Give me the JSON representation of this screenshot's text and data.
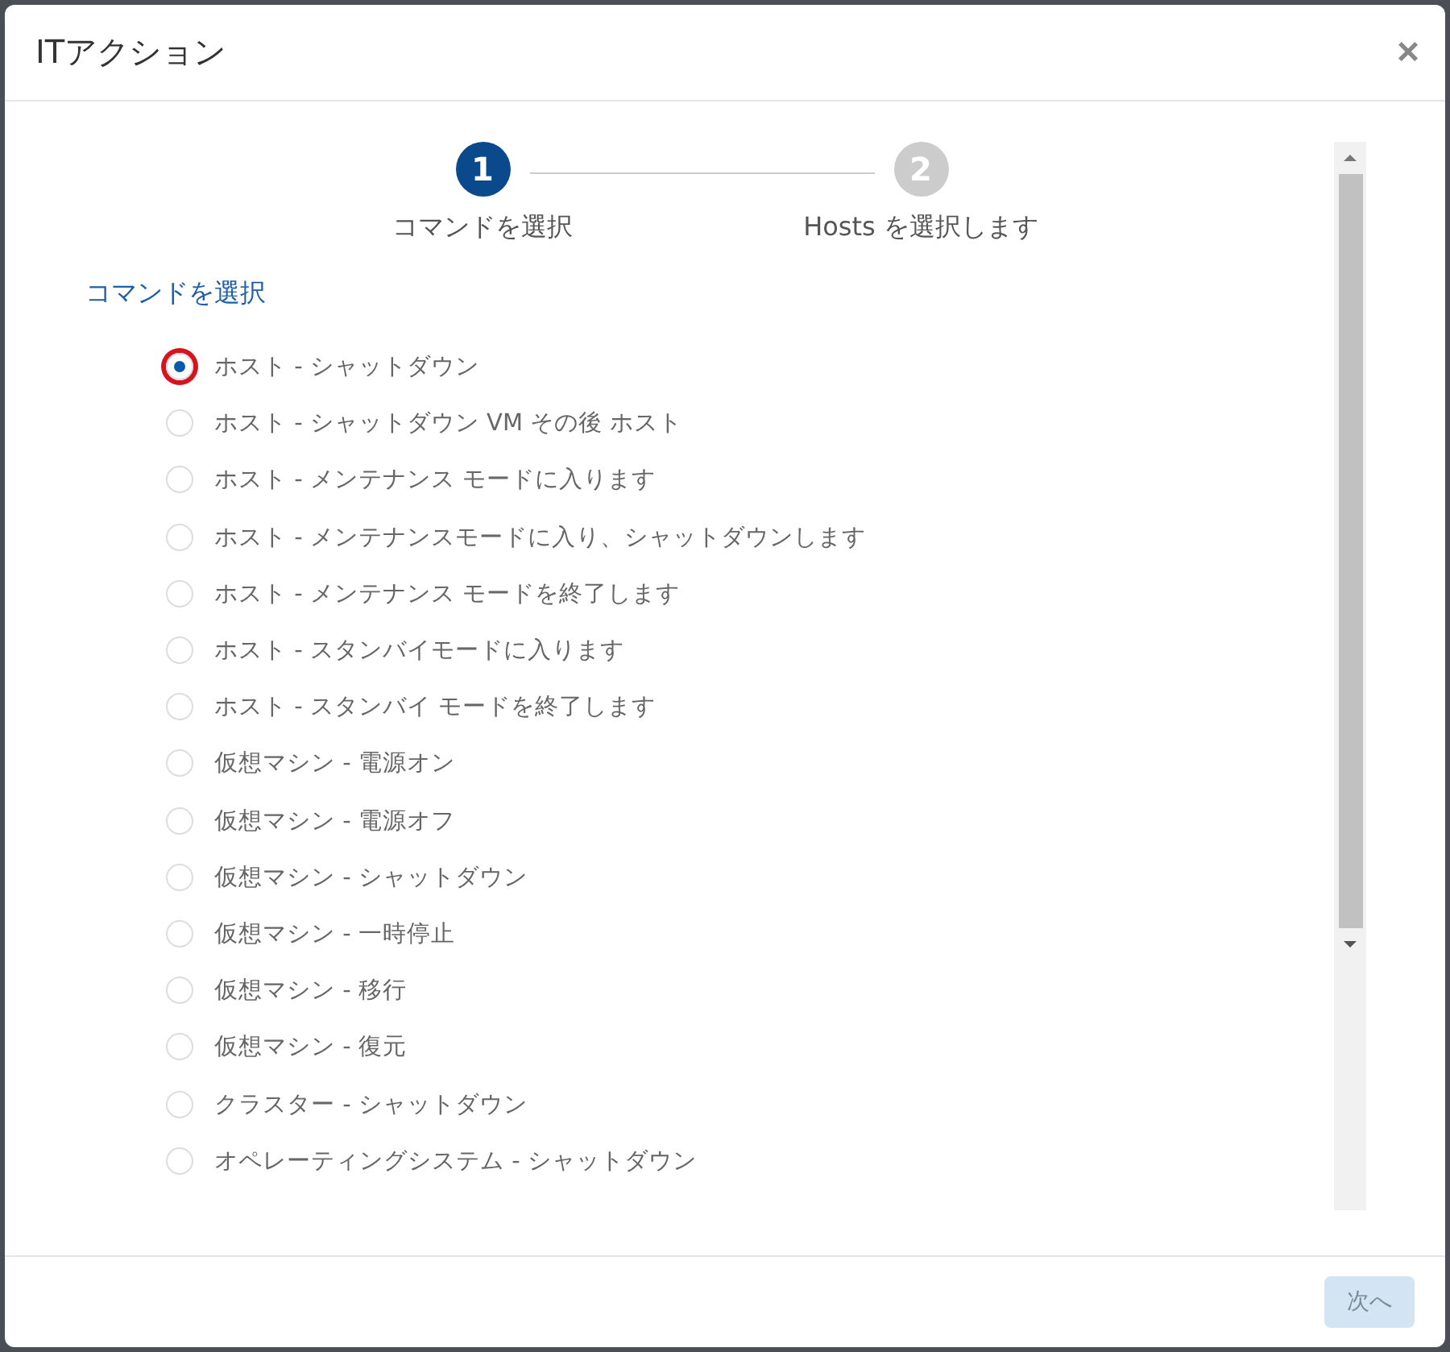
{
  "dialog": {
    "title": "ITアクション",
    "close": "×"
  },
  "steps": [
    {
      "number": "1",
      "label": "コマンドを選択",
      "selected": true
    },
    {
      "number": "2",
      "label": "Hosts を選択します",
      "selected": false
    }
  ],
  "section_label": "コマンドを選択",
  "options": [
    {
      "label": "ホスト - シャットダウン",
      "selected": true,
      "highlighted": true
    },
    {
      "label": "ホスト - シャットダウン VM その後 ホスト",
      "selected": false,
      "highlighted": false
    },
    {
      "label": "ホスト - メンテナンス モードに入ります",
      "selected": false,
      "highlighted": false
    },
    {
      "label": "ホスト - メンテナンスモードに入り、シャットダウンします",
      "selected": false,
      "highlighted": false
    },
    {
      "label": "ホスト - メンテナンス モードを終了します",
      "selected": false,
      "highlighted": false
    },
    {
      "label": "ホスト - スタンバイモードに入ります",
      "selected": false,
      "highlighted": false
    },
    {
      "label": "ホスト - スタンバイ モードを終了します",
      "selected": false,
      "highlighted": false
    },
    {
      "label": "仮想マシン - 電源オン",
      "selected": false,
      "highlighted": false
    },
    {
      "label": "仮想マシン - 電源オフ",
      "selected": false,
      "highlighted": false
    },
    {
      "label": "仮想マシン - シャットダウン",
      "selected": false,
      "highlighted": false
    },
    {
      "label": "仮想マシン - 一時停止",
      "selected": false,
      "highlighted": false
    },
    {
      "label": "仮想マシン - 移行",
      "selected": false,
      "highlighted": false
    },
    {
      "label": "仮想マシン - 復元",
      "selected": false,
      "highlighted": false
    },
    {
      "label": "クラスター - シャットダウン",
      "selected": false,
      "highlighted": false
    },
    {
      "label": "オペレーティングシステム - シャットダウン",
      "selected": false,
      "highlighted": false
    }
  ],
  "footer": {
    "next_button": {
      "label": "次へ",
      "disabled": true
    }
  }
}
